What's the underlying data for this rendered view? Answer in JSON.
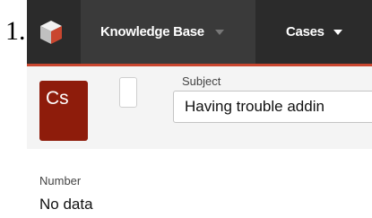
{
  "list_marker": "1.",
  "nav": {
    "knowledge_base": "Knowledge Base",
    "cases": "Cases"
  },
  "record": {
    "avatar_initials": "Cs",
    "subject_label": "Subject",
    "subject_value": "Having trouble addin",
    "number_label": "Number",
    "number_value": "No data"
  },
  "colors": {
    "nav_bg": "#2b2b2b",
    "accent": "#c9462f",
    "avatar_bg": "#8e1c0b"
  },
  "icons": {
    "logo": "cube-logo-icon",
    "dropdown": "caret-down-icon"
  }
}
